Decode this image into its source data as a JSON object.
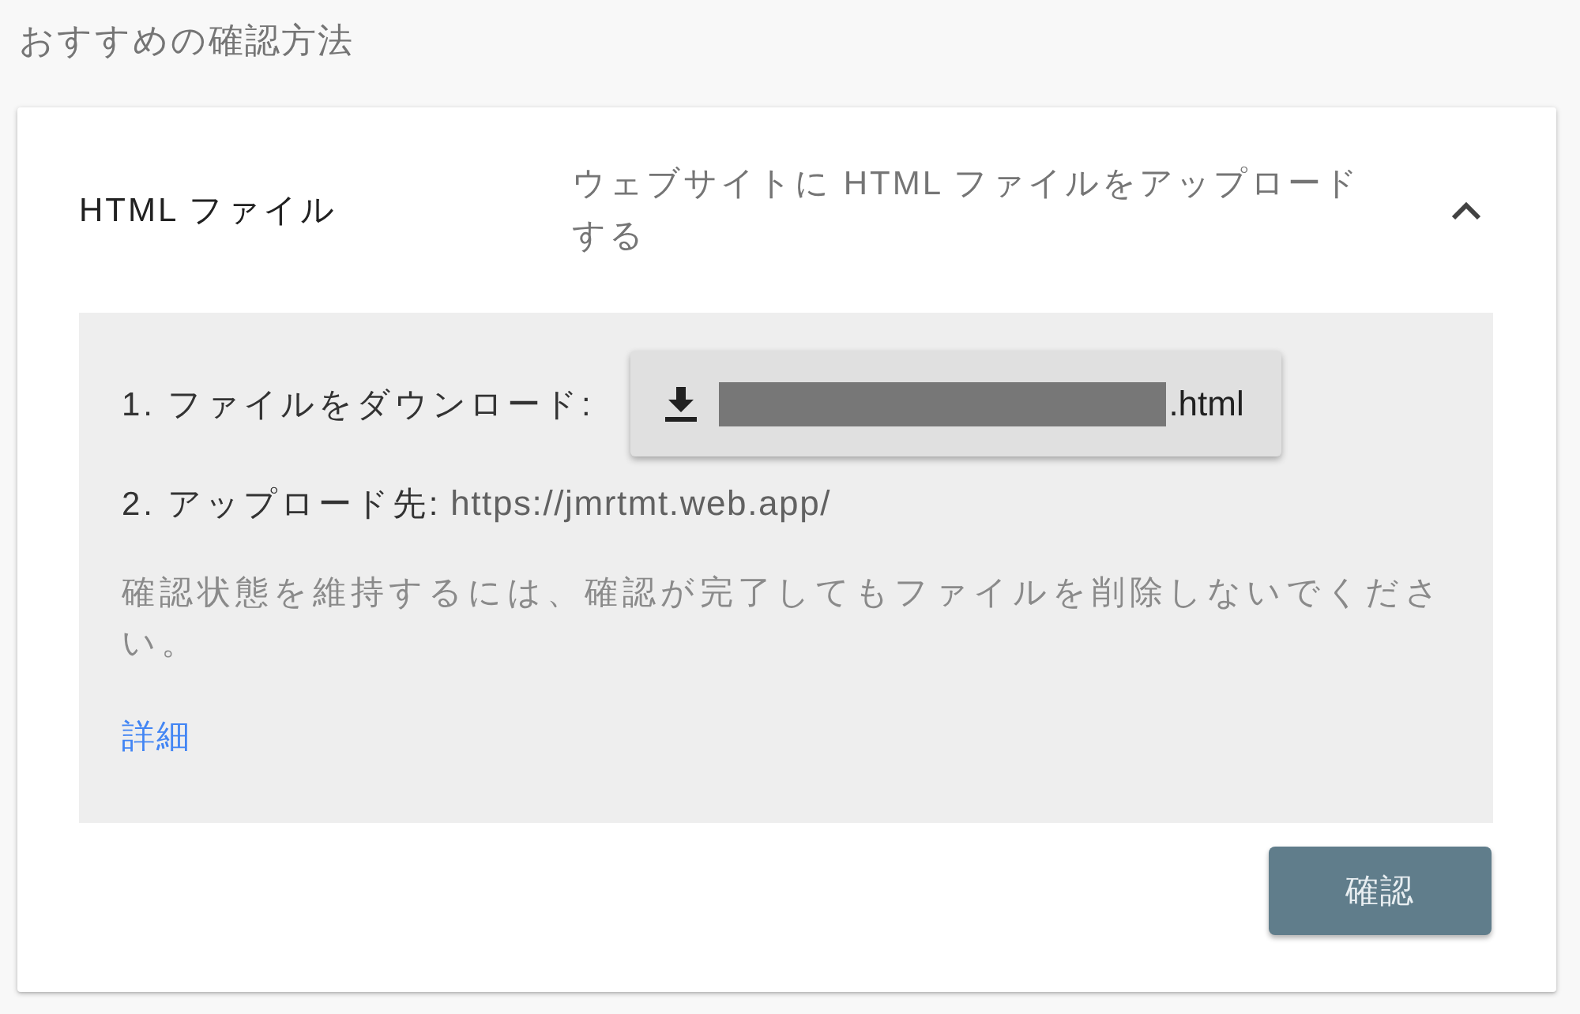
{
  "heading": "おすすめの確認方法",
  "method": {
    "title": "HTML ファイル",
    "description": "ウェブサイトに HTML ファイルをアップロードする",
    "expanded": true,
    "steps": [
      {
        "kind": "download",
        "label": "1. ファイルをダウンロード:",
        "file": {
          "redacted": true,
          "name": ".html"
        }
      },
      {
        "kind": "destination",
        "label": "2. アップロード先:",
        "url": "https://jmrtmt.web.app/"
      }
    ],
    "note": "確認状態を維持するには、確認が完了してもファイルを削除しないでください。",
    "link": "詳細"
  },
  "confirm_button": "確認"
}
